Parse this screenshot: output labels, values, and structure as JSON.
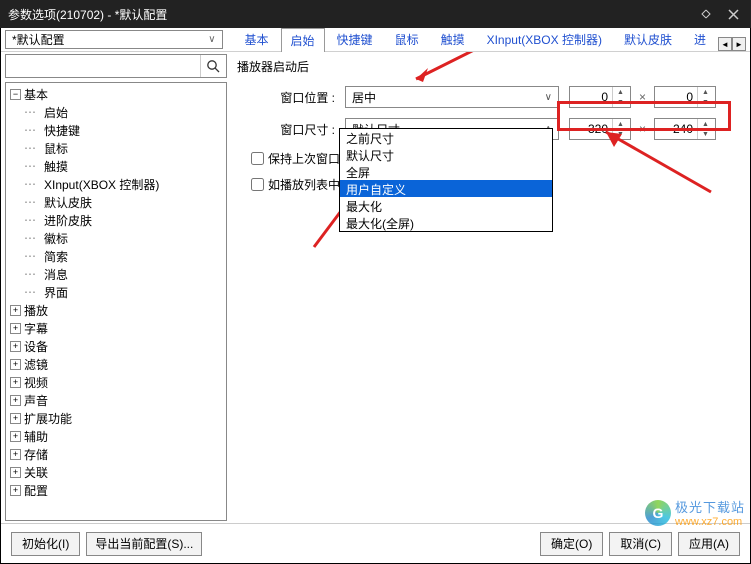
{
  "window": {
    "title": "参数选项(210702) - *默认配置"
  },
  "config_dropdown": {
    "value": "*默认配置"
  },
  "tabs": {
    "items": [
      "基本",
      "启始",
      "快捷键",
      "鼠标",
      "触摸",
      "XInput(XBOX 控制器)",
      "默认皮肤",
      "进"
    ],
    "active_index": 1
  },
  "search": {
    "placeholder": ""
  },
  "tree": {
    "root": {
      "label": "基本",
      "expanded": true
    },
    "children": [
      "启始",
      "快捷键",
      "鼠标",
      "触摸",
      "XInput(XBOX 控制器)",
      "默认皮肤",
      "进阶皮肤",
      "徽标",
      "简索",
      "消息",
      "界面"
    ],
    "groups": [
      "播放",
      "字幕",
      "设备",
      "滤镜",
      "视频",
      "声音",
      "扩展功能",
      "辅助",
      "存储",
      "关联",
      "配置"
    ]
  },
  "main": {
    "group_title": "播放器启动后",
    "win_pos_label": "窗口位置 :",
    "win_pos_value": "居中",
    "win_pos_x": "0",
    "win_pos_y": "0",
    "win_size_label": "窗口尺寸 :",
    "win_size_value": "默认尺寸",
    "win_size_w": "320",
    "win_size_h": "240",
    "size_options": [
      "之前尺寸",
      "默认尺寸",
      "全屏",
      "用户自定义",
      "最大化",
      "最大化(全屏)"
    ],
    "size_selected_index": 3,
    "keep_last": "保持上次窗口状态",
    "if_playlist": "如播放列表中存在"
  },
  "buttons": {
    "init": "初始化(I)",
    "export": "导出当前配置(S)...",
    "ok": "确定(O)",
    "cancel": "取消(C)",
    "apply": "应用(A)"
  },
  "watermark": {
    "text1": "极光下载站",
    "text2": "www.xz7.com"
  }
}
